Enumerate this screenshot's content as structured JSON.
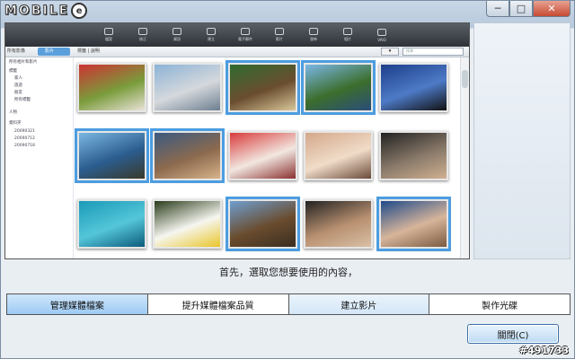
{
  "branding": {
    "logo_text": "MOBILE",
    "logo_glyph": "e",
    "watermark": "#491733"
  },
  "window_controls": {
    "minimize": "─",
    "maximize": "□",
    "close": "✕"
  },
  "toolbar": {
    "items": [
      "檔案",
      "修正",
      "資訊",
      "建立",
      "電子郵件",
      "影片",
      "發佈",
      "相片",
      "VAIO"
    ]
  },
  "subbar": {
    "view_tag": "所有影像",
    "selected_tab": "影片",
    "tags": "標籤 | 說明",
    "search_placeholder": "搜尋"
  },
  "nav": {
    "items": [
      "所有相片和影片",
      "標籤",
      "家人",
      "旅遊",
      "朋友",
      "所有標籤",
      "人物",
      "資料夾",
      "20090321",
      "20090712",
      "20090718"
    ]
  },
  "thumbs": [
    {
      "colors": [
        "#c33",
        "#7a9c3b",
        "#e8e2d6"
      ],
      "selected": false
    },
    {
      "colors": [
        "#8cb3d6",
        "#d5d8dc",
        "#6d7f90"
      ],
      "selected": false
    },
    {
      "colors": [
        "#2f6b2f",
        "#6a4d2f",
        "#d9c79a"
      ],
      "selected": true
    },
    {
      "colors": [
        "#7ab7e6",
        "#3c6e2c",
        "#2a4d7a"
      ],
      "selected": true
    },
    {
      "colors": [
        "#1d3f8a",
        "#4d7ac6",
        "#111"
      ],
      "selected": false
    },
    {
      "colors": [
        "#7bb6e2",
        "#2b5d8f",
        "#3a3a2a"
      ],
      "selected": true
    },
    {
      "colors": [
        "#3b5a80",
        "#8c6a4e",
        "#d8b38a"
      ],
      "selected": true
    },
    {
      "colors": [
        "#d83b3b",
        "#f2e7e0",
        "#8a3030"
      ],
      "selected": false
    },
    {
      "colors": [
        "#d4a78a",
        "#f0dcc8",
        "#6b4a3a"
      ],
      "selected": false
    },
    {
      "colors": [
        "#222",
        "#8a7a6a",
        "#d0b090"
      ],
      "selected": false
    },
    {
      "colors": [
        "#1b9ab8",
        "#54c6d9",
        "#0c5a7a"
      ],
      "selected": false
    },
    {
      "colors": [
        "#2a3b1a",
        "#f6f6f0",
        "#e9c62a"
      ],
      "selected": false
    },
    {
      "colors": [
        "#6f9fd0",
        "#6a4c2e",
        "#3a2d20"
      ],
      "selected": true
    },
    {
      "colors": [
        "#222",
        "#b89070",
        "#d9c0a6"
      ],
      "selected": false
    },
    {
      "colors": [
        "#1f4a8a",
        "#d7b59a",
        "#7a5a40"
      ],
      "selected": true
    }
  ],
  "prompt": "首先，選取您想要使用的內容，",
  "tabs": [
    {
      "label": "管理媒體檔案",
      "state": "active"
    },
    {
      "label": "提升媒體檔案品質",
      "state": "normal"
    },
    {
      "label": "建立影片",
      "state": "alt"
    },
    {
      "label": "製作光碟",
      "state": "normal"
    }
  ],
  "close_button": "關閉(C)"
}
